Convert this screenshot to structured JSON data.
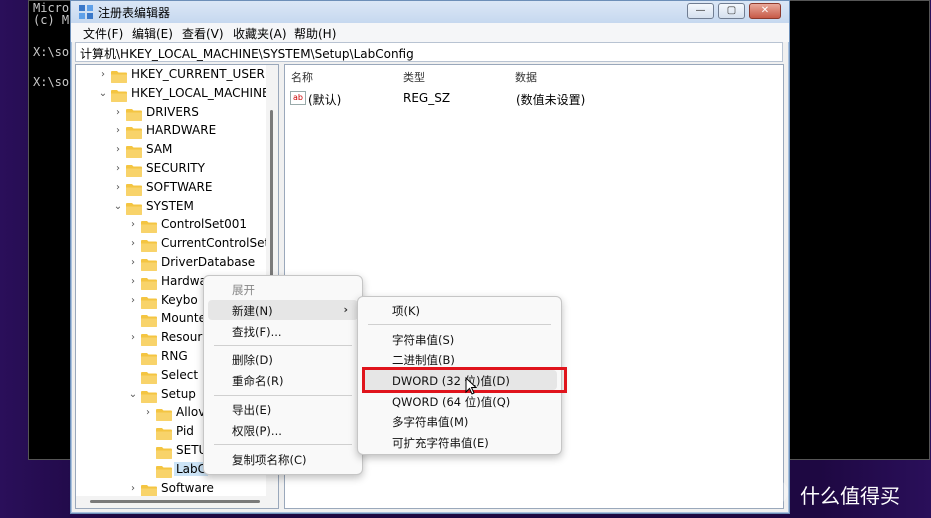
{
  "console": {
    "line1": "Micro",
    "line2": "(c) M",
    "line3": "X:\\so",
    "line4": "X:\\so"
  },
  "window": {
    "title": "注册表编辑器",
    "min_glyph": "—",
    "max_glyph": "▢",
    "close_glyph": "✕"
  },
  "menu": {
    "file": "文件(F)",
    "edit": "编辑(E)",
    "view": "查看(V)",
    "favorites": "收藏夹(A)",
    "help": "帮助(H)"
  },
  "address": "计算机\\HKEY_LOCAL_MACHINE\\SYSTEM\\Setup\\LabConfig",
  "tree": [
    {
      "label": "HKEY_CURRENT_USER",
      "chev": "›"
    },
    {
      "label": "HKEY_LOCAL_MACHINE",
      "chev": "⌄"
    },
    {
      "label": "DRIVERS",
      "chev": "›"
    },
    {
      "label": "HARDWARE",
      "chev": "›"
    },
    {
      "label": "SAM",
      "chev": "›"
    },
    {
      "label": "SECURITY",
      "chev": "›"
    },
    {
      "label": "SOFTWARE",
      "chev": "›"
    },
    {
      "label": "SYSTEM",
      "chev": "⌄"
    },
    {
      "label": "ControlSet001",
      "chev": "›"
    },
    {
      "label": "CurrentControlSet",
      "chev": "›"
    },
    {
      "label": "DriverDatabase",
      "chev": "›"
    },
    {
      "label": "Hardwa",
      "chev": "›"
    },
    {
      "label": "Keybo",
      "chev": "›"
    },
    {
      "label": "Mounte",
      "chev": ""
    },
    {
      "label": "Resour",
      "chev": "›"
    },
    {
      "label": "RNG",
      "chev": ""
    },
    {
      "label": "Select",
      "chev": ""
    },
    {
      "label": "Setup",
      "chev": "⌄"
    },
    {
      "label": "Allov",
      "chev": "›"
    },
    {
      "label": "Pid",
      "chev": ""
    },
    {
      "label": "SETU",
      "chev": ""
    },
    {
      "label": "LabC",
      "chev": ""
    },
    {
      "label": "Software",
      "chev": "›"
    }
  ],
  "list": {
    "headers": {
      "name": "名称",
      "type": "类型",
      "data": "数据"
    },
    "row": {
      "icon_text": "ab",
      "name": "(默认)",
      "type": "REG_SZ",
      "data": "(数值未设置)"
    }
  },
  "context_menu": {
    "expand": "展开",
    "new": "新建(N)",
    "new_arrow": "›",
    "find": "查找(F)...",
    "delete": "删除(D)",
    "rename": "重命名(R)",
    "export": "导出(E)",
    "permissions": "权限(P)...",
    "copy_key_name": "复制项名称(C)"
  },
  "submenu": {
    "key": "项(K)",
    "string": "字符串值(S)",
    "binary": "二进制值(B)",
    "dword": "DWORD (32 位)值(D)",
    "qword": "QWORD (64 位)值(Q)",
    "multi_string": "多字符串值(M)",
    "expand_string": "可扩充字符串值(E)"
  },
  "watermark": {
    "badge": "值",
    "text": "什么值得买"
  },
  "colors": {
    "highlight_box": "#e0141c",
    "folder": "#f4c542",
    "selection": "#cce4f7"
  }
}
